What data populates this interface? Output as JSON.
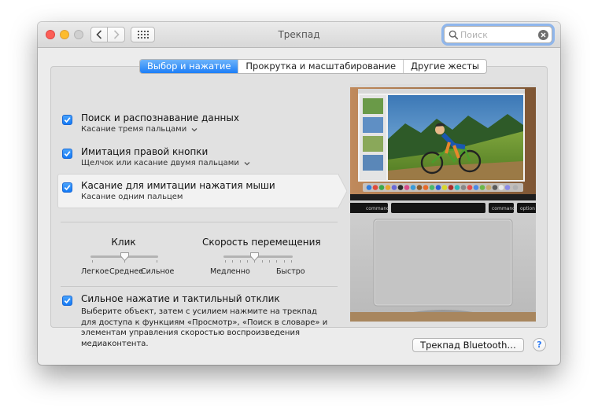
{
  "window": {
    "title": "Трекпад"
  },
  "search": {
    "placeholder": "Поиск",
    "value": ""
  },
  "tabs": [
    {
      "label": "Выбор и нажатие",
      "active": true
    },
    {
      "label": "Прокрутка и масштабирование",
      "active": false
    },
    {
      "label": "Другие жесты",
      "active": false
    }
  ],
  "options": [
    {
      "title": "Поиск и распознавание данных",
      "subtitle": "Касание тремя пальцами",
      "checked": true,
      "has_dropdown": true
    },
    {
      "title": "Имитация правой кнопки",
      "subtitle": "Щелчок или касание двумя пальцами",
      "checked": true,
      "has_dropdown": true
    },
    {
      "title": "Касание для имитации нажатия мыши",
      "subtitle": "Касание одним пальцем",
      "checked": true,
      "has_dropdown": false
    }
  ],
  "click_slider": {
    "label": "Клик",
    "ticks": [
      "Легкое",
      "Среднее",
      "Сильное"
    ],
    "value_index": 1
  },
  "speed_slider": {
    "label": "Скорость перемещения",
    "min_label": "Медленно",
    "max_label": "Быстро",
    "value_fraction": 0.45
  },
  "force_touch": {
    "title": "Сильное нажатие и тактильный отклик",
    "checked": true,
    "description": "Выберите объект, затем с усилием нажмите на трекпад для доступа к функциям «Просмотр», «Поиск в словаре» и элементам управления скоростью воспроизведения медиаконтента."
  },
  "bluetooth_button": {
    "label": "Трекпад Bluetooth…"
  },
  "help_button": {
    "label": "?"
  },
  "preview": {
    "keys": [
      "command",
      "command",
      "option"
    ]
  },
  "colors": {
    "accent": "#1d7ef7",
    "close": "#fc5f57",
    "minimize": "#fdbc2e"
  }
}
